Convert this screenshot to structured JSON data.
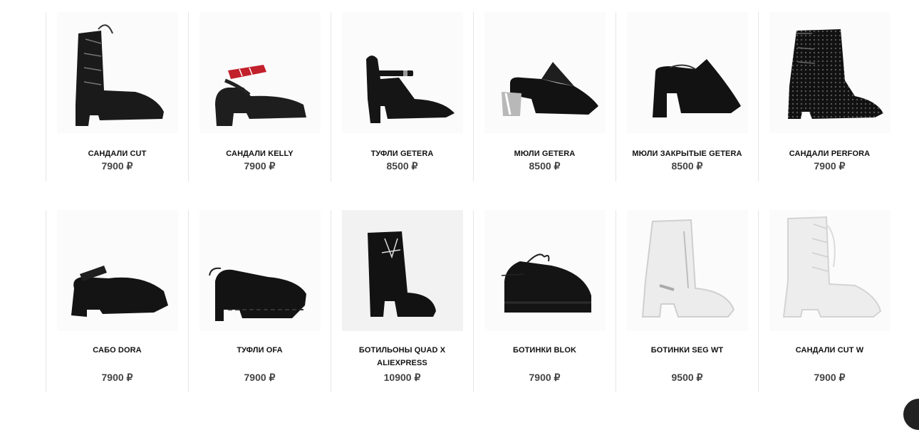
{
  "products": [
    {
      "name": "САНДАЛИ CUT",
      "price": "7900 ₽",
      "image": "lace-up-sandal-black-icon"
    },
    {
      "name": "САНДАЛИ KELLY",
      "price": "7900 ₽",
      "image": "strap-sandal-red-icon"
    },
    {
      "name": "ТУФЛИ GETERA",
      "price": "8500 ₽",
      "image": "ankle-strap-pump-icon"
    },
    {
      "name": "МЮЛИ GETERA",
      "price": "8500 ₽",
      "image": "mule-metal-heel-icon"
    },
    {
      "name": "МЮЛИ ЗАКРЫТЫЕ GETERA",
      "price": "8500 ₽",
      "image": "closed-mule-icon"
    },
    {
      "name": "САНДАЛИ PERFORA",
      "price": "7900 ₽",
      "image": "perforated-sandal-icon"
    },
    {
      "name": "САБО DORA",
      "price": "7900 ₽",
      "image": "clog-icon"
    },
    {
      "name": "ТУФЛИ OFA",
      "price": "7900 ₽",
      "image": "platform-shoe-icon"
    },
    {
      "name": "БОТИЛЬОНЫ QUAD X ALIEXPRESS",
      "price": "10900 ₽",
      "image": "ankle-boot-icon"
    },
    {
      "name": "БОТИНКИ BLOK",
      "price": "7900 ₽",
      "image": "platform-oxford-icon"
    },
    {
      "name": "БОТИНКИ SEG WT",
      "price": "9500 ₽",
      "image": "transparent-boot-icon"
    },
    {
      "name": "САНДАЛИ CUT W",
      "price": "7900 ₽",
      "image": "lace-up-sandal-white-icon"
    }
  ]
}
